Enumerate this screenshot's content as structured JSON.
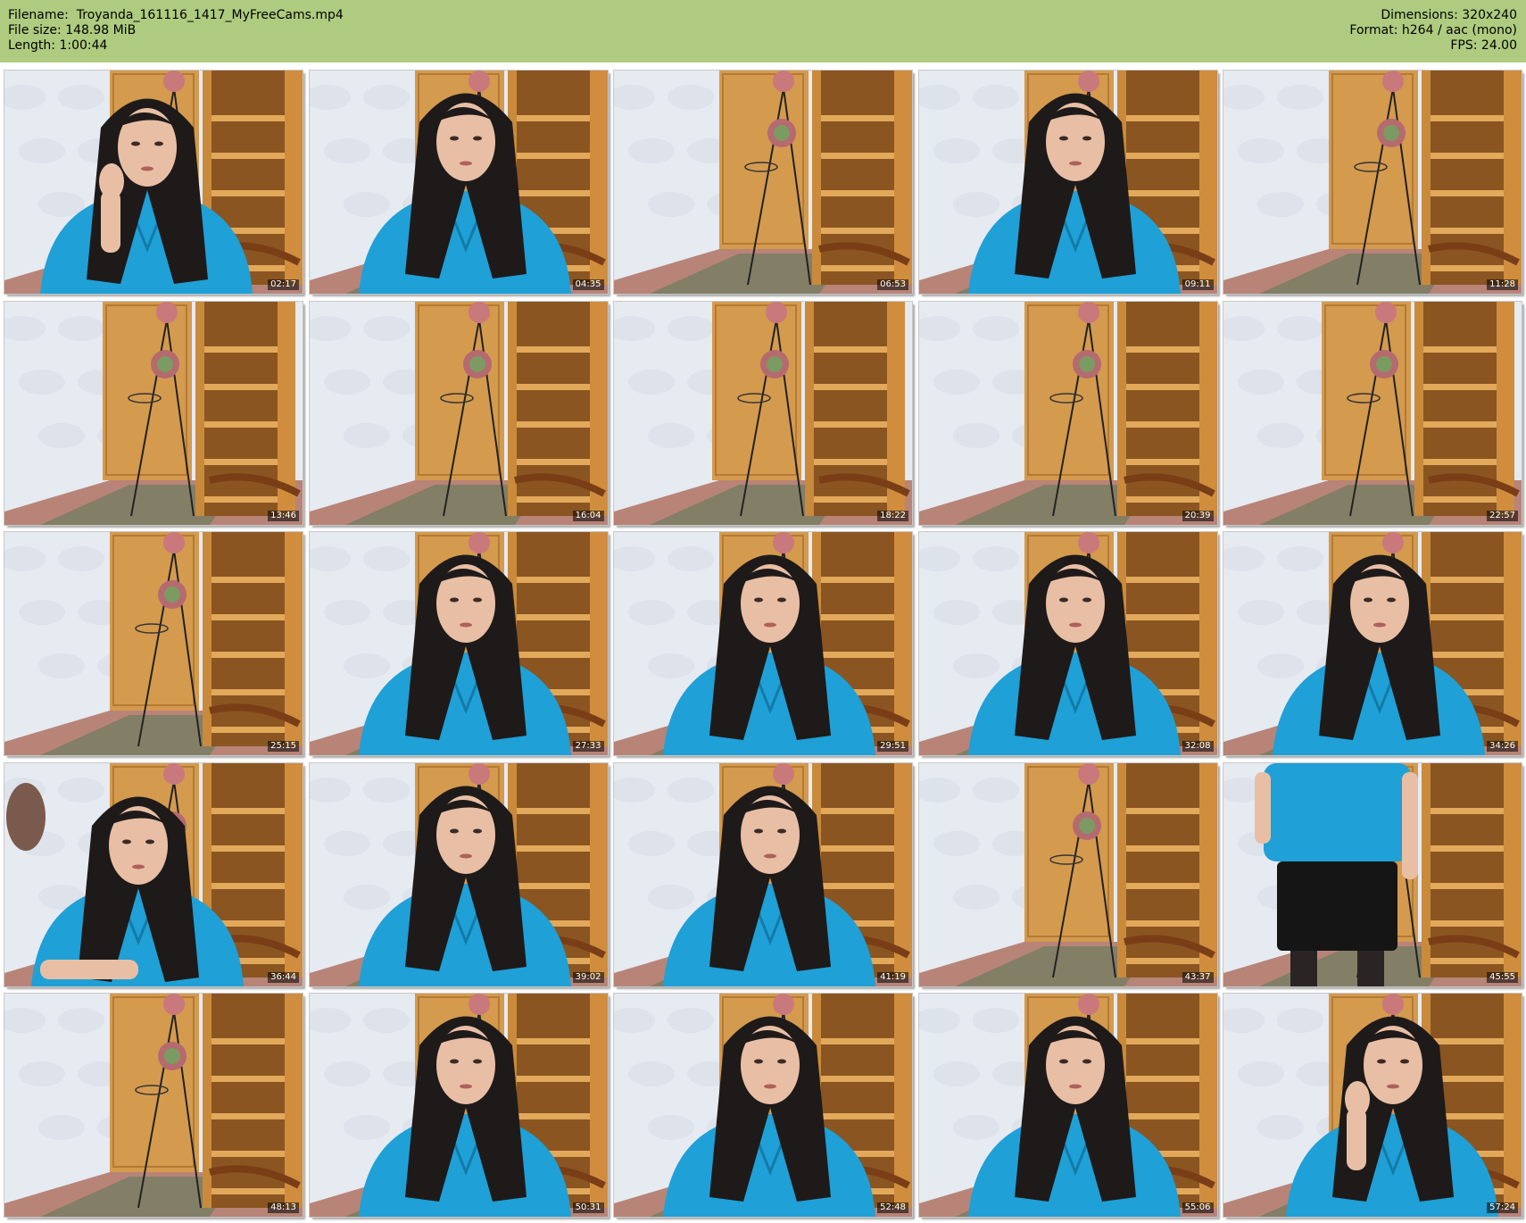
{
  "header": {
    "left": [
      {
        "label": "Filename:",
        "value": "Troyanda_161116_1417_MyFreeCams.mp4"
      },
      {
        "label": "File size:",
        "value": "148.98 MiB"
      },
      {
        "label": "Length:",
        "value": "1:00:44"
      }
    ],
    "right": [
      {
        "label": "Dimensions:",
        "value": "320x240"
      },
      {
        "label": "Format:",
        "value": "h264 / aac (mono)"
      },
      {
        "label": "FPS:",
        "value": "24.00"
      }
    ]
  },
  "thumbnails": [
    {
      "time": "02:17",
      "person": "close",
      "pose": "hand"
    },
    {
      "time": "04:35",
      "person": "center",
      "pose": "sit"
    },
    {
      "time": "06:53",
      "person": "none",
      "pose": "none"
    },
    {
      "time": "09:11",
      "person": "center",
      "pose": "sit"
    },
    {
      "time": "11:28",
      "person": "none",
      "pose": "none"
    },
    {
      "time": "13:46",
      "person": "none",
      "pose": "none"
    },
    {
      "time": "16:04",
      "person": "none",
      "pose": "none"
    },
    {
      "time": "18:22",
      "person": "none",
      "pose": "none"
    },
    {
      "time": "20:39",
      "person": "none",
      "pose": "none"
    },
    {
      "time": "22:57",
      "person": "none",
      "pose": "none"
    },
    {
      "time": "25:15",
      "person": "none",
      "pose": "none"
    },
    {
      "time": "27:33",
      "person": "center",
      "pose": "sit"
    },
    {
      "time": "29:51",
      "person": "center",
      "pose": "sit"
    },
    {
      "time": "32:08",
      "person": "center",
      "pose": "sit"
    },
    {
      "time": "34:26",
      "person": "center",
      "pose": "sit"
    },
    {
      "time": "36:44",
      "person": "left",
      "pose": "lean"
    },
    {
      "time": "39:02",
      "person": "center",
      "pose": "sit"
    },
    {
      "time": "41:19",
      "person": "center",
      "pose": "sit"
    },
    {
      "time": "43:37",
      "person": "none",
      "pose": "none"
    },
    {
      "time": "45:55",
      "person": "stand",
      "pose": "stand"
    },
    {
      "time": "48:13",
      "person": "none",
      "pose": "none"
    },
    {
      "time": "50:31",
      "person": "center",
      "pose": "sit"
    },
    {
      "time": "52:48",
      "person": "center",
      "pose": "sit"
    },
    {
      "time": "55:06",
      "person": "center",
      "pose": "sit"
    },
    {
      "time": "57:24",
      "person": "right",
      "pose": "hand"
    }
  ],
  "colors": {
    "header_bg": "#aecb7f",
    "wall": "#e6eaf1",
    "cabinet": "#c98a3c",
    "cabinet_dark": "#8a5521",
    "shirt": "#1fa0d6",
    "hair": "#1e1a19",
    "skin": "#e8bfa5",
    "floor": "#b88478"
  }
}
